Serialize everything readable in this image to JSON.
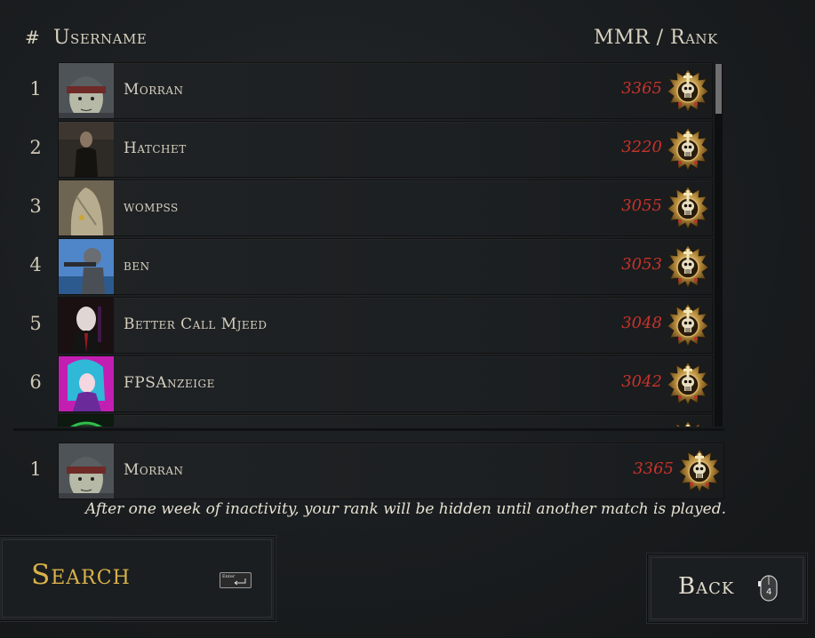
{
  "header": {
    "num": "#",
    "username": "Username",
    "mmr_rank": "MMR / Rank"
  },
  "leaderboard": [
    {
      "pos": "1",
      "name": "Morran",
      "mmr": "3365",
      "avatar": "hooded-man-avatar"
    },
    {
      "pos": "2",
      "name": "Hatchet",
      "mmr": "3220",
      "avatar": "dark-figure-avatar"
    },
    {
      "pos": "3",
      "name": "wompss",
      "mmr": "3055",
      "avatar": "ghost-sheet-avatar"
    },
    {
      "pos": "4",
      "name": "ben",
      "mmr": "3053",
      "avatar": "soldier-avatar"
    },
    {
      "pos": "5",
      "name": "Better Call Mjeed",
      "mmr": "3048",
      "avatar": "agent-avatar"
    },
    {
      "pos": "6",
      "name": "FPSAnzeige",
      "mmr": "3042",
      "avatar": "anime-girl-avatar"
    },
    {
      "pos": "",
      "name": "",
      "mmr": "",
      "avatar": "green-dark-avatar"
    }
  ],
  "self_entry": {
    "pos": "1",
    "name": "Morran",
    "mmr": "3365",
    "avatar": "hooded-man-avatar"
  },
  "notice": "After one week of inactivity, your rank will be hidden until another match is played.",
  "buttons": {
    "search": "Search",
    "search_key": "Enter",
    "back": "Back",
    "back_key": "4"
  },
  "rank_icon": "gold-skull-rank-icon",
  "colors": {
    "mmr": "#c7332a",
    "search": "#d9b24a"
  }
}
